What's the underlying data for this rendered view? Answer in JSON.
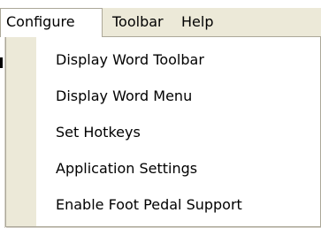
{
  "menubar": {
    "items": [
      {
        "label": "Configure",
        "open": true
      },
      {
        "label": "Toolbar",
        "open": false
      },
      {
        "label": "Help",
        "open": false
      }
    ]
  },
  "configure_menu": {
    "items": [
      {
        "label": "Display Word Toolbar"
      },
      {
        "label": "Display Word Menu"
      },
      {
        "label": "Set Hotkeys"
      },
      {
        "label": "Application Settings"
      },
      {
        "label": "Enable Foot Pedal Support"
      }
    ]
  },
  "colors": {
    "menubar_bg": "#ece9d8",
    "menu_bg": "#ffffff",
    "border": "#aca899"
  }
}
